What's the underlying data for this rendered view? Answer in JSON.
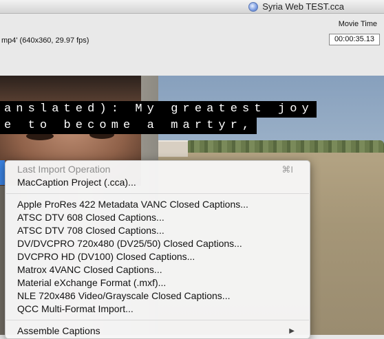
{
  "window": {
    "title": "Syria Web TEST.cca",
    "title_icon": "document-cca-icon"
  },
  "info": {
    "file_info": "mp4'  (640x360, 29.97 fps)",
    "movie_time_label": "Movie Time",
    "movie_time_value": "00:00:35.13"
  },
  "video": {
    "caption_lines": [
      "anslated): My greatest joy",
      "e to become a martyr,"
    ]
  },
  "menu": {
    "header": {
      "label": "Last Import Operation",
      "shortcut": "⌘I"
    },
    "items_group1": [
      "MacCaption Project (.cca)..."
    ],
    "items_group2": [
      "Apple ProRes 422 Metadata VANC Closed Captions...",
      "ATSC DTV 608 Closed Captions...",
      "ATSC DTV 708 Closed Captions...",
      "DV/DVCPRO 720x480 (DV25/50) Closed Captions...",
      "DVCPRO HD (DV100) Closed Captions...",
      "Matrox 4VANC Closed Captions...",
      "Material eXchange Format (.mxf)...",
      "NLE 720x486 Video/Grayscale Closed Captions...",
      "QCC Multi-Format Import..."
    ],
    "submenu": {
      "label": "Assemble Captions",
      "arrow": "▶"
    }
  }
}
